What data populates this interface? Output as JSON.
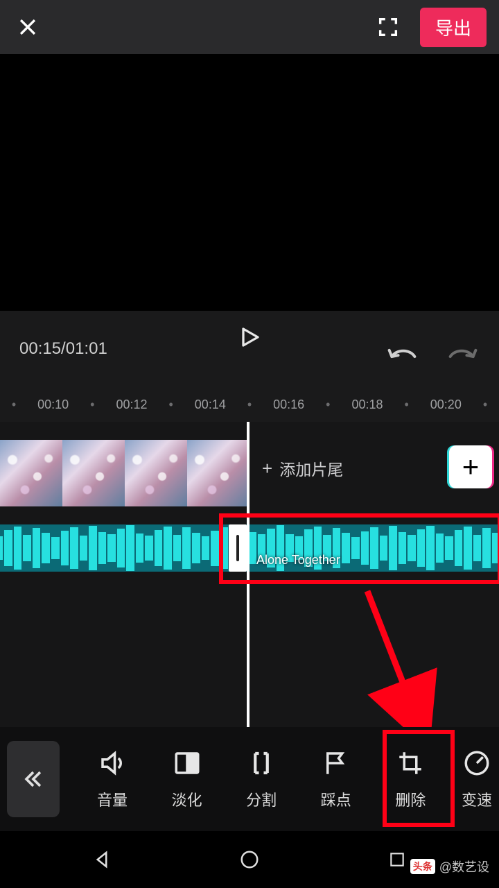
{
  "header": {
    "export_label": "导出"
  },
  "player": {
    "current_time": "00:15",
    "total_time": "01:01",
    "time_display": "00:15/01:01"
  },
  "ruler": {
    "ticks": [
      "00:10",
      "00:12",
      "00:14",
      "00:16",
      "00:18",
      "00:20"
    ]
  },
  "timeline": {
    "add_tail_label": "添加片尾",
    "audio": {
      "clip_name": "Alone Together"
    }
  },
  "tools": [
    {
      "id": "volume",
      "label": "音量",
      "icon": "volume-icon"
    },
    {
      "id": "fade",
      "label": "淡化",
      "icon": "fade-icon"
    },
    {
      "id": "split",
      "label": "分割",
      "icon": "split-icon"
    },
    {
      "id": "beat",
      "label": "踩点",
      "icon": "flag-icon"
    },
    {
      "id": "delete",
      "label": "删除",
      "icon": "crop-delete-icon"
    },
    {
      "id": "speed",
      "label": "变速",
      "icon": "gauge-icon"
    }
  ],
  "watermark": {
    "brand": "头条",
    "author": "@数艺设"
  },
  "colors": {
    "accent": "#ee2b5b",
    "highlight": "#ff0016",
    "audio_wave": "#27e0e0"
  }
}
